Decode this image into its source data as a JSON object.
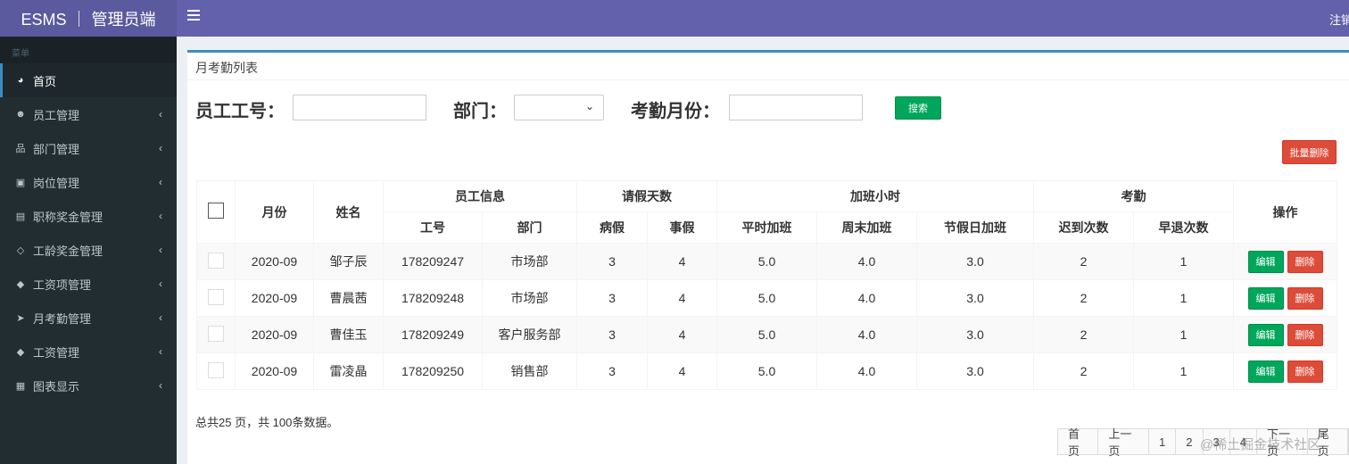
{
  "app": {
    "logo_text": "ESMS ｜ 管理员端",
    "logout_label": "注销"
  },
  "sidebar": {
    "header": "菜单",
    "items": [
      {
        "label": "首页",
        "icon": "dashboard-icon",
        "glyph": "◕",
        "active": true,
        "has_arrow": false
      },
      {
        "label": "员工管理",
        "icon": "users-icon",
        "glyph": "☻",
        "active": false,
        "has_arrow": true
      },
      {
        "label": "部门管理",
        "icon": "sitemap-icon",
        "glyph": "品",
        "active": false,
        "has_arrow": true
      },
      {
        "label": "岗位管理",
        "icon": "briefcase-icon",
        "glyph": "▣",
        "active": false,
        "has_arrow": true
      },
      {
        "label": "职称奖金管理",
        "icon": "id-card-icon",
        "glyph": "▤",
        "active": false,
        "has_arrow": true
      },
      {
        "label": "工龄奖金管理",
        "icon": "code-icon",
        "glyph": "◇",
        "active": false,
        "has_arrow": true
      },
      {
        "label": "工资项管理",
        "icon": "tags-icon",
        "glyph": "◆",
        "active": false,
        "has_arrow": true
      },
      {
        "label": "月考勤管理",
        "icon": "paper-plane-icon",
        "glyph": "➤",
        "active": false,
        "has_arrow": true
      },
      {
        "label": "工资管理",
        "icon": "tag-icon",
        "glyph": "◆",
        "active": false,
        "has_arrow": true
      },
      {
        "label": "图表显示",
        "icon": "file-text-icon",
        "glyph": "▦",
        "active": false,
        "has_arrow": true
      }
    ],
    "arrow_glyph": "‹"
  },
  "box": {
    "title": "月考勤列表"
  },
  "filter": {
    "emp_no_label": "员工工号：",
    "emp_no_value": "",
    "dept_label": "部门：",
    "dept_value": "",
    "month_label": "考勤月份：",
    "month_value": "",
    "search_label": "搜索"
  },
  "batch_delete_label": "批量删除",
  "table": {
    "headers": {
      "month": "月份",
      "name": "姓名",
      "emp_info": "员工信息",
      "leave_days": "请假天数",
      "overtime_hours": "加班小时",
      "attendance": "考勤",
      "ops": "操作",
      "emp_no": "工号",
      "dept": "部门",
      "sick": "病假",
      "personal": "事假",
      "ot_normal": "平时加班",
      "ot_weekend": "周末加班",
      "ot_holiday": "节假日加班",
      "late": "迟到次数",
      "early": "早退次数"
    },
    "rows": [
      {
        "month": "2020-09",
        "name": "邹子辰",
        "emp_no": "178209247",
        "dept": "市场部",
        "sick": "3",
        "personal": "4",
        "ot_normal": "5.0",
        "ot_weekend": "4.0",
        "ot_holiday": "3.0",
        "late": "2",
        "early": "1"
      },
      {
        "month": "2020-09",
        "name": "曹晨茜",
        "emp_no": "178209248",
        "dept": "市场部",
        "sick": "3",
        "personal": "4",
        "ot_normal": "5.0",
        "ot_weekend": "4.0",
        "ot_holiday": "3.0",
        "late": "2",
        "early": "1"
      },
      {
        "month": "2020-09",
        "name": "曹佳玉",
        "emp_no": "178209249",
        "dept": "客户服务部",
        "sick": "3",
        "personal": "4",
        "ot_normal": "5.0",
        "ot_weekend": "4.0",
        "ot_holiday": "3.0",
        "late": "2",
        "early": "1"
      },
      {
        "month": "2020-09",
        "name": "雷凌晶",
        "emp_no": "178209250",
        "dept": "销售部",
        "sick": "3",
        "personal": "4",
        "ot_normal": "5.0",
        "ot_weekend": "4.0",
        "ot_holiday": "3.0",
        "late": "2",
        "early": "1"
      }
    ],
    "edit_label": "编辑",
    "delete_label": "删除"
  },
  "summary": "总共25 页，共 100条数据。",
  "pager": [
    "首页",
    "上一页",
    "1",
    "2",
    "3",
    "4",
    "下一页",
    "尾页"
  ],
  "watermark": "@稀土掘金技术社区",
  "colors": {
    "topbar": "#6360ac",
    "logo_bg": "#5b5a9e",
    "sidebar": "#222d32",
    "success": "#00a65a",
    "danger": "#dd4b39",
    "primary": "#3c8dbc"
  }
}
